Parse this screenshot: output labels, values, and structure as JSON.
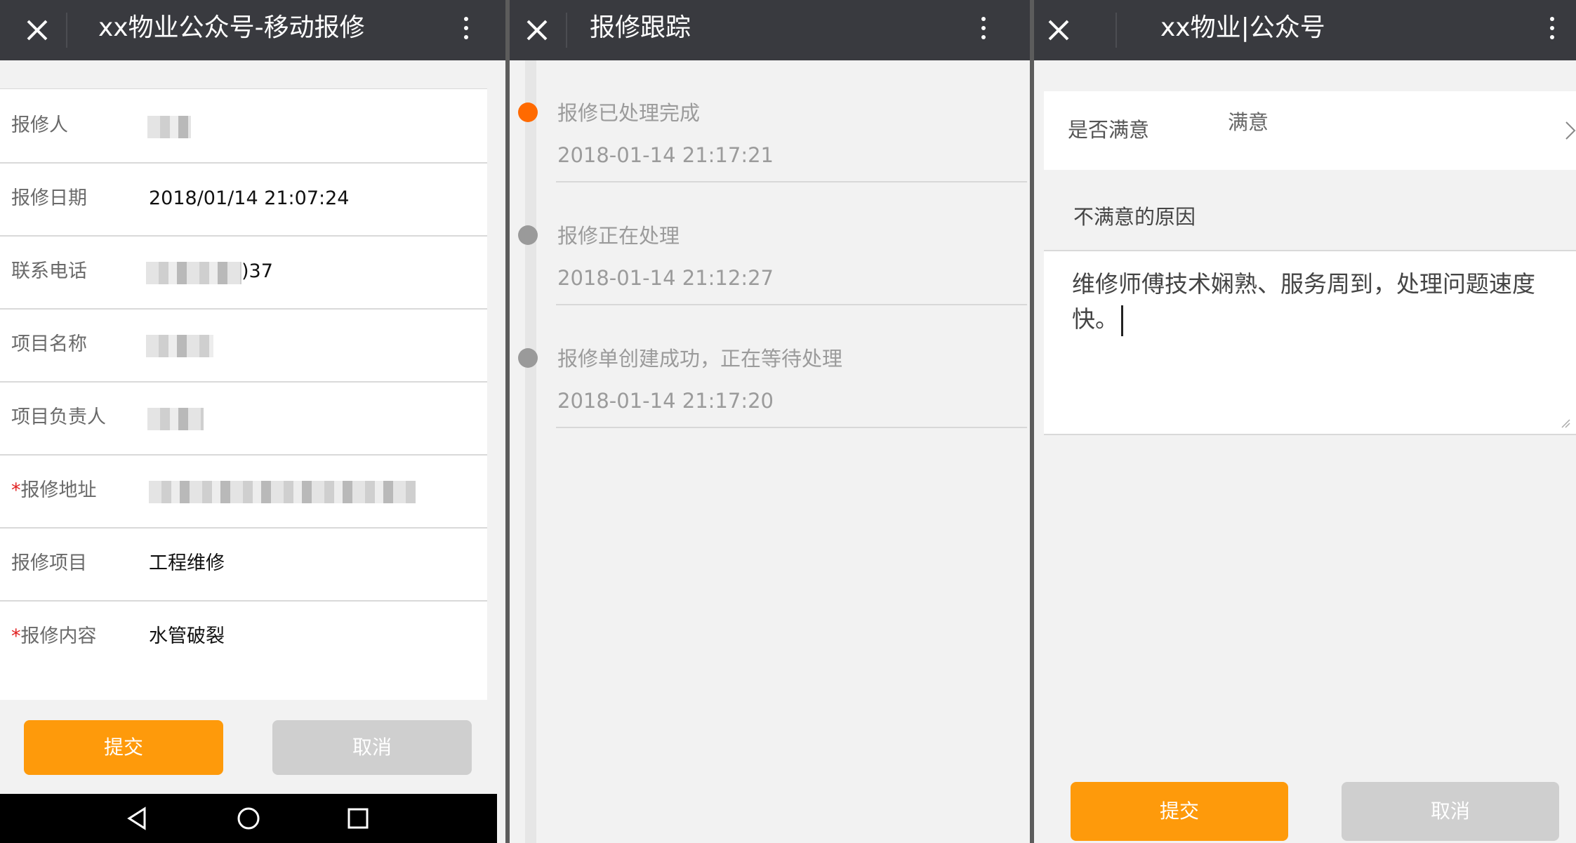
{
  "panels": {
    "repair_form": {
      "title": "xx物业公众号-移动报修",
      "fields": [
        {
          "label": "报修人",
          "value": "",
          "required": false,
          "redacted": true
        },
        {
          "label": "报修日期",
          "value": "2018/01/14 21:07:24",
          "required": false,
          "redacted": false
        },
        {
          "label": "联系电话",
          "value": ")37",
          "required": false,
          "redacted": true
        },
        {
          "label": "项目名称",
          "value": "",
          "required": false,
          "redacted": true
        },
        {
          "label": "项目负责人",
          "value": "",
          "required": false,
          "redacted": true
        },
        {
          "label": "报修地址",
          "value": "",
          "required": true,
          "redacted": true
        },
        {
          "label": "报修项目",
          "value": "工程维修",
          "required": false,
          "redacted": false
        },
        {
          "label": "报修内容",
          "value": "水管破裂",
          "required": true,
          "redacted": false
        }
      ],
      "required_mark": "*",
      "submit_label": "提交",
      "cancel_label": "取消"
    },
    "tracking": {
      "title": "报修跟踪",
      "events": [
        {
          "status": "报修已处理完成",
          "time": "2018-01-14 21:17:21",
          "color": "#ff6a00"
        },
        {
          "status": "报修正在处理",
          "time": "2018-01-14 21:12:27",
          "color": "#9a9a9a"
        },
        {
          "status": "报修单创建成功，正在等待处理",
          "time": "2018-01-14 21:17:20",
          "color": "#9a9a9a"
        }
      ]
    },
    "feedback": {
      "title": "xx物业|公众号",
      "satisfied_label": "是否满意",
      "satisfied_value": "满意",
      "reason_label": "不满意的原因",
      "reason_text": "维修师傅技术娴熟、服务周到，处理问题速度快。",
      "submit_label": "提交",
      "cancel_label": "取消"
    }
  },
  "colors": {
    "titlebar": "#393a3f",
    "accent_orange": "#fe9a0b",
    "button_gray": "#cfcfcf",
    "active_dot": "#ff6a00",
    "inactive_dot": "#9a9a9a"
  },
  "icons": [
    "close-icon",
    "more-icon",
    "back-triangle-icon",
    "home-circle-icon",
    "recents-square-icon",
    "chevron-right-icon"
  ]
}
